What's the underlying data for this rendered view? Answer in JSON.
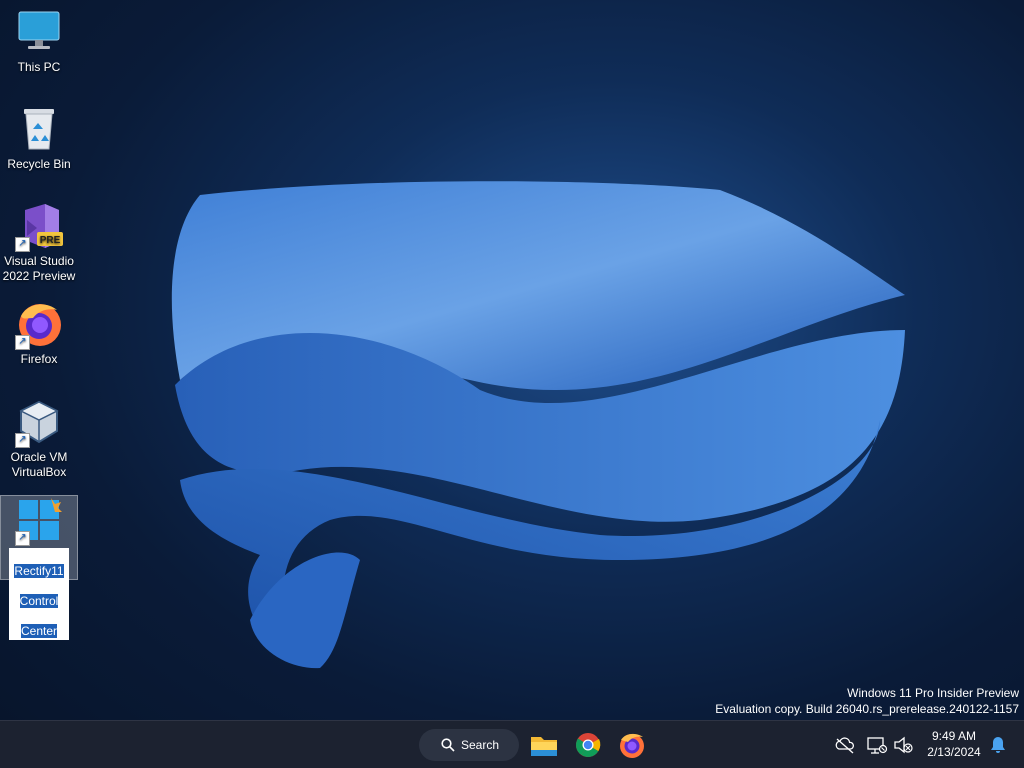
{
  "desktop": {
    "icons": [
      {
        "label": "This PC"
      },
      {
        "label": "Recycle Bin"
      },
      {
        "label": "Visual Studio\n2022 Preview",
        "badge": "PRE"
      },
      {
        "label": "Firefox"
      },
      {
        "label": "Oracle VM\nVirtualBox"
      },
      {
        "label": "Rectify11\nControl\nCenter"
      }
    ],
    "selected_icon_label_parts": [
      "Rectify11",
      "Control",
      "Center"
    ]
  },
  "watermark": {
    "line1": "Windows 11 Pro Insider Preview",
    "line2": "Evaluation copy. Build 26040.rs_prerelease.240122-1157"
  },
  "taskbar": {
    "search_label": "Search",
    "apps": [
      "file-explorer-icon",
      "chrome-icon",
      "firefox-icon"
    ],
    "tray": [
      "cloud-off-icon",
      "network-icon",
      "volume-muted-icon"
    ],
    "time": "9:49 AM",
    "date": "2/13/2024"
  },
  "colors": {
    "accent": "#1e5fb6",
    "taskbar": "#1c2230"
  }
}
